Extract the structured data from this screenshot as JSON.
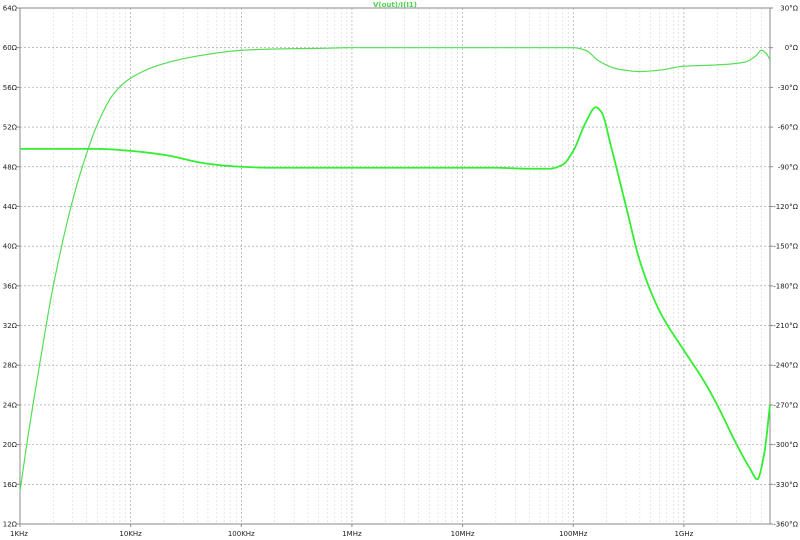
{
  "chart_data": {
    "type": "line",
    "title": "V(out)/I(I1)",
    "x_scale": "log",
    "xlim": [
      1000,
      6000000000
    ],
    "x_ticks": [
      {
        "value": 1000,
        "label": "1KHz"
      },
      {
        "value": 10000,
        "label": "10KHz"
      },
      {
        "value": 100000,
        "label": "100KHz"
      },
      {
        "value": 1000000,
        "label": "1MHz"
      },
      {
        "value": 10000000,
        "label": "10MHz"
      },
      {
        "value": 100000000,
        "label": "100MHz"
      },
      {
        "value": 1000000000,
        "label": "1GHz"
      }
    ],
    "ylim_left": [
      12,
      64
    ],
    "y_ticks_left": [
      {
        "value": 64,
        "label": "64Ω"
      },
      {
        "value": 60,
        "label": "60Ω"
      },
      {
        "value": 56,
        "label": "56Ω"
      },
      {
        "value": 52,
        "label": "52Ω"
      },
      {
        "value": 48,
        "label": "48Ω"
      },
      {
        "value": 44,
        "label": "44Ω"
      },
      {
        "value": 40,
        "label": "40Ω"
      },
      {
        "value": 36,
        "label": "36Ω"
      },
      {
        "value": 32,
        "label": "32Ω"
      },
      {
        "value": 28,
        "label": "28Ω"
      },
      {
        "value": 24,
        "label": "24Ω"
      },
      {
        "value": 20,
        "label": "20Ω"
      },
      {
        "value": 16,
        "label": "16Ω"
      },
      {
        "value": 12,
        "label": "12Ω"
      }
    ],
    "ylim_right": [
      -360,
      30
    ],
    "y_ticks_right": [
      {
        "value": 30,
        "label": "30°Ω"
      },
      {
        "value": 0,
        "label": "0°Ω"
      },
      {
        "value": -30,
        "label": "-30°Ω"
      },
      {
        "value": -60,
        "label": "-60°Ω"
      },
      {
        "value": -90,
        "label": "-90°Ω"
      },
      {
        "value": -120,
        "label": "-120°Ω"
      },
      {
        "value": -150,
        "label": "-150°Ω"
      },
      {
        "value": -180,
        "label": "-180°Ω"
      },
      {
        "value": -210,
        "label": "-210°Ω"
      },
      {
        "value": -240,
        "label": "-240°Ω"
      },
      {
        "value": -270,
        "label": "-270°Ω"
      },
      {
        "value": -300,
        "label": "-300°Ω"
      },
      {
        "value": -330,
        "label": "-330°Ω"
      },
      {
        "value": -360,
        "label": "-360°Ω"
      }
    ],
    "grid": true,
    "series": [
      {
        "axis": "left",
        "color": "#33ee33",
        "x": [
          1000,
          2000,
          5000,
          10000,
          20000,
          50000,
          100000,
          200000,
          500000,
          1000000,
          2000000,
          5000000,
          10000000,
          20000000,
          40000000,
          60000000,
          80000000,
          100000000,
          130000000,
          160000000,
          180000000,
          220000000,
          300000000,
          400000000,
          600000000,
          1000000000,
          1500000000,
          2000000000,
          3000000000,
          4000000000,
          4600000000,
          5300000000,
          6000000000
        ],
        "y": [
          49.8,
          49.8,
          49.8,
          49.6,
          49.2,
          48.3,
          48.0,
          47.9,
          47.9,
          47.9,
          47.9,
          47.9,
          47.9,
          47.9,
          47.8,
          47.8,
          48.2,
          49.6,
          52.5,
          54.0,
          53.5,
          50.0,
          44.0,
          38.5,
          33.5,
          29.5,
          26.5,
          24.0,
          20.0,
          17.5,
          16.5,
          19.0,
          24.0
        ]
      },
      {
        "axis": "right",
        "color": "#55dd55",
        "x": [
          1000,
          1200,
          1500,
          2000,
          3000,
          4000,
          5000,
          7000,
          10000,
          20000,
          50000,
          100000,
          200000,
          500000,
          1000000,
          3000000,
          10000000,
          50000000,
          100000000,
          130000000,
          170000000,
          250000000,
          400000000,
          600000000,
          1000000000,
          2000000000,
          3500000000,
          4500000000,
          5000000000,
          5500000000,
          6000000000
        ],
        "y": [
          -335,
          -290,
          -240,
          -180,
          -115,
          -80,
          -58,
          -35,
          -23,
          -12,
          -5,
          -2,
          -1,
          -0.5,
          0,
          0,
          0,
          0,
          0,
          -2,
          -10,
          -16,
          -18,
          -17,
          -14,
          -13,
          -11,
          -6,
          -2,
          -4,
          -9
        ]
      }
    ]
  }
}
